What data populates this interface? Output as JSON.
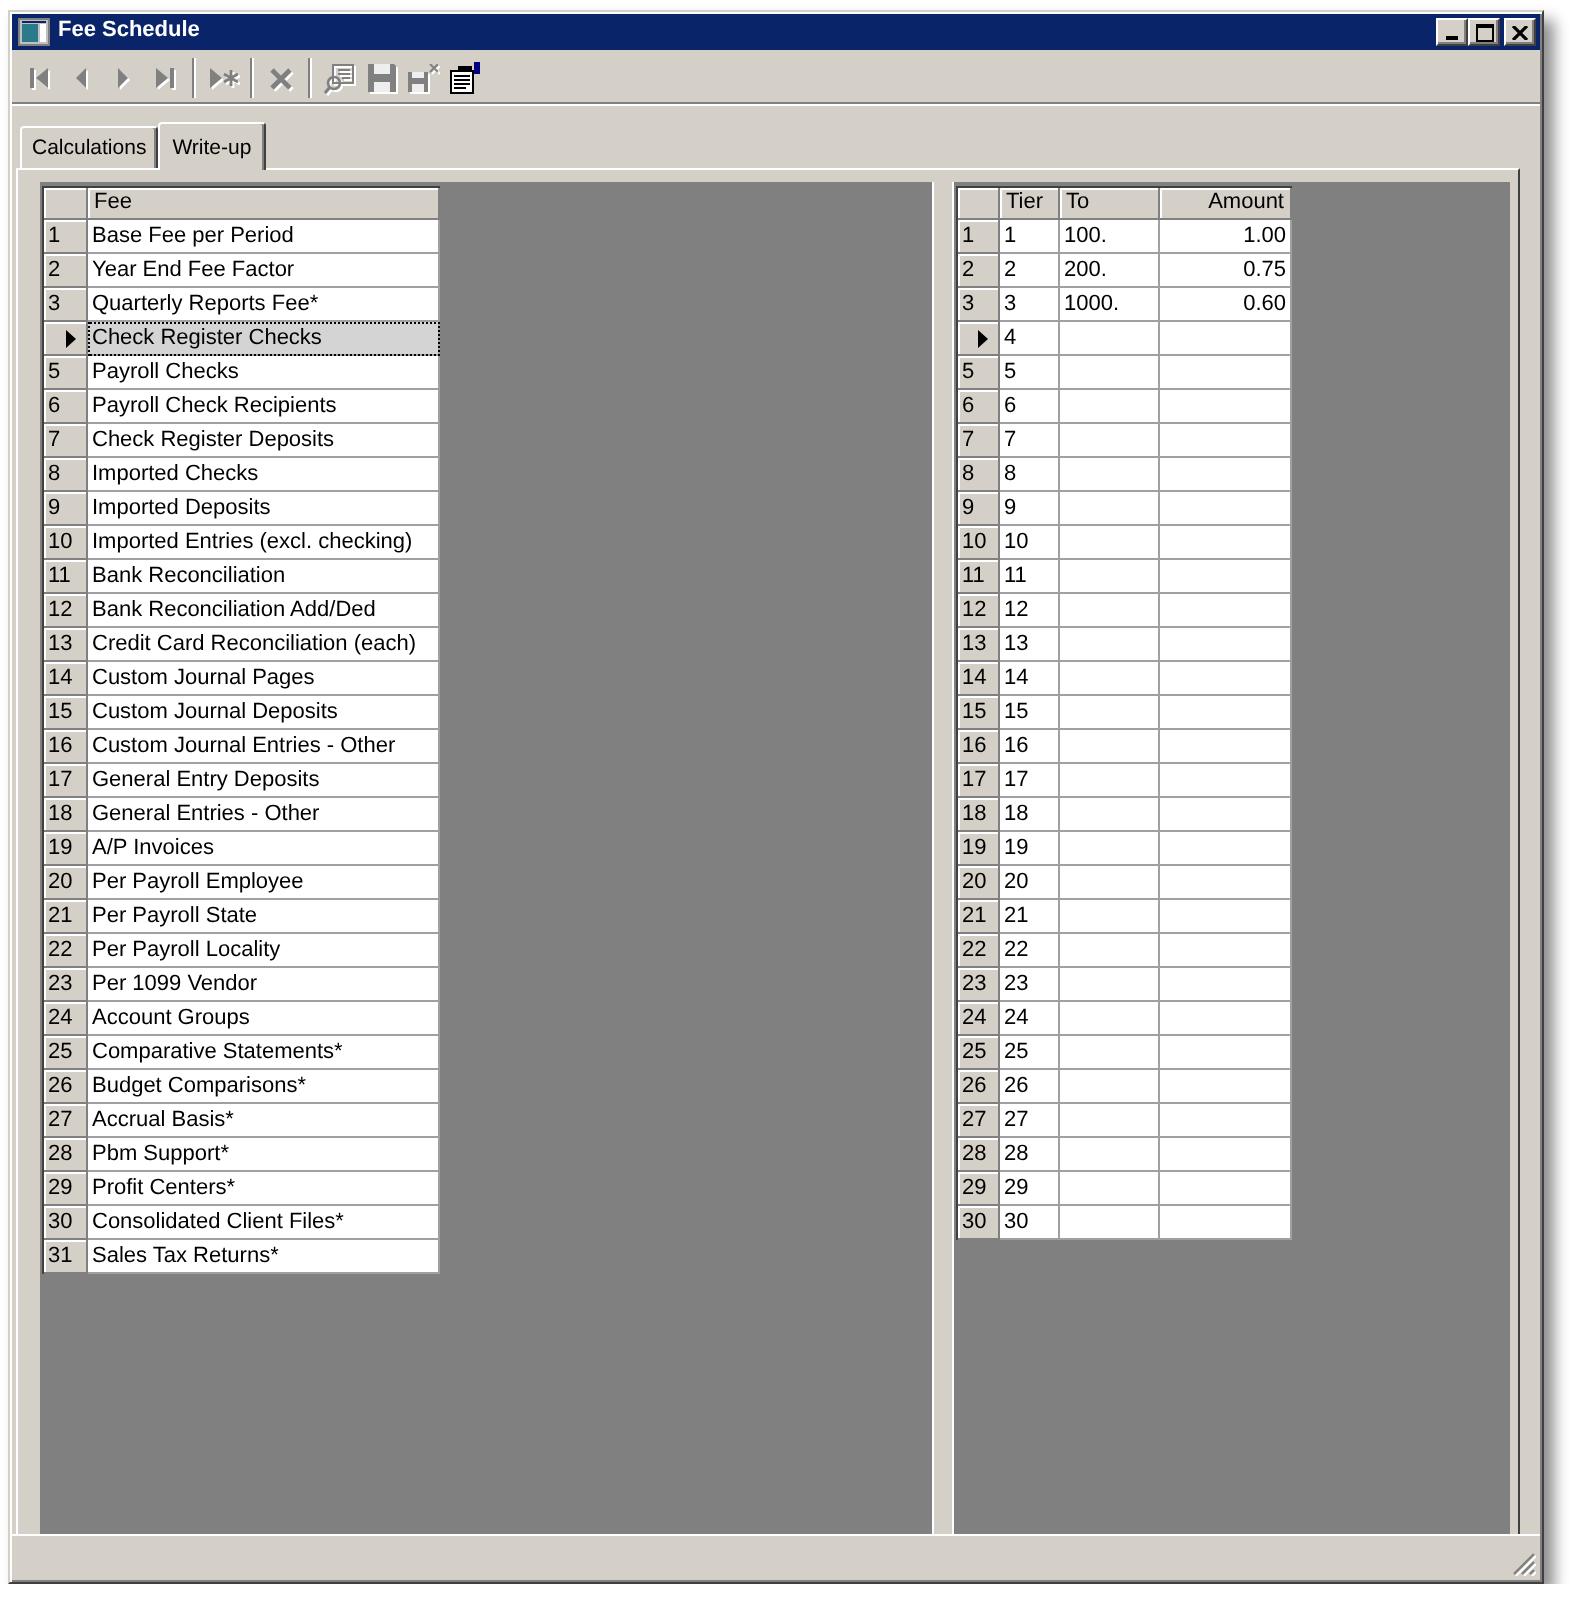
{
  "window": {
    "title": "Fee Schedule"
  },
  "toolbar": {
    "groups": [
      {
        "buttons": [
          {
            "kind": "first",
            "disabled": true
          },
          {
            "kind": "previous",
            "disabled": true
          },
          {
            "kind": "next",
            "disabled": true
          },
          {
            "kind": "last",
            "disabled": true
          }
        ]
      },
      {
        "buttons": [
          {
            "kind": "new",
            "disabled": true
          }
        ]
      },
      {
        "buttons": [
          {
            "kind": "delete",
            "disabled": true
          }
        ]
      },
      {
        "buttons": [
          {
            "kind": "find",
            "disabled": true
          },
          {
            "kind": "save",
            "disabled": true
          },
          {
            "kind": "discard",
            "disabled": true
          },
          {
            "kind": "properties",
            "disabled": false
          }
        ]
      }
    ]
  },
  "tabs": [
    {
      "label": "Calculations",
      "selected": false
    },
    {
      "label": "Write-up",
      "selected": true
    }
  ],
  "fee_grid": {
    "columns": [
      "Fee"
    ],
    "rows": [
      {
        "number": "1",
        "cells": [
          "Base Fee per Period"
        ],
        "current": false,
        "selected": false
      },
      {
        "number": "2",
        "cells": [
          "Year End Fee Factor"
        ],
        "current": false,
        "selected": false
      },
      {
        "number": "3",
        "cells": [
          "Quarterly Reports Fee*"
        ],
        "current": false,
        "selected": false
      },
      {
        "cells": [
          "Check Register Checks"
        ],
        "current": true,
        "selected": true
      },
      {
        "number": "5",
        "cells": [
          "Payroll Checks"
        ],
        "current": false,
        "selected": false
      },
      {
        "number": "6",
        "cells": [
          "Payroll Check Recipients"
        ],
        "current": false,
        "selected": false
      },
      {
        "number": "7",
        "cells": [
          "Check Register Deposits"
        ],
        "current": false,
        "selected": false
      },
      {
        "number": "8",
        "cells": [
          "Imported Checks"
        ],
        "current": false,
        "selected": false
      },
      {
        "number": "9",
        "cells": [
          "Imported Deposits"
        ],
        "current": false,
        "selected": false
      },
      {
        "number": "10",
        "cells": [
          "Imported Entries (excl. checking)"
        ],
        "current": false,
        "selected": false
      },
      {
        "number": "11",
        "cells": [
          "Bank Reconciliation"
        ],
        "current": false,
        "selected": false
      },
      {
        "number": "12",
        "cells": [
          "Bank Reconciliation Add/Ded"
        ],
        "current": false,
        "selected": false
      },
      {
        "number": "13",
        "cells": [
          "Credit Card Reconciliation (each)"
        ],
        "current": false,
        "selected": false
      },
      {
        "number": "14",
        "cells": [
          "Custom Journal Pages"
        ],
        "current": false,
        "selected": false
      },
      {
        "number": "15",
        "cells": [
          "Custom Journal Deposits"
        ],
        "current": false,
        "selected": false
      },
      {
        "number": "16",
        "cells": [
          "Custom Journal Entries - Other"
        ],
        "current": false,
        "selected": false
      },
      {
        "number": "17",
        "cells": [
          "General Entry Deposits"
        ],
        "current": false,
        "selected": false
      },
      {
        "number": "18",
        "cells": [
          "General Entries - Other"
        ],
        "current": false,
        "selected": false
      },
      {
        "number": "19",
        "cells": [
          "A/P Invoices"
        ],
        "current": false,
        "selected": false
      },
      {
        "number": "20",
        "cells": [
          "Per Payroll Employee"
        ],
        "current": false,
        "selected": false
      },
      {
        "number": "21",
        "cells": [
          "Per Payroll State"
        ],
        "current": false,
        "selected": false
      },
      {
        "number": "22",
        "cells": [
          "Per Payroll Locality"
        ],
        "current": false,
        "selected": false
      },
      {
        "number": "23",
        "cells": [
          "Per 1099 Vendor"
        ],
        "current": false,
        "selected": false
      },
      {
        "number": "24",
        "cells": [
          "Account Groups"
        ],
        "current": false,
        "selected": false
      },
      {
        "number": "25",
        "cells": [
          "Comparative Statements*"
        ],
        "current": false,
        "selected": false
      },
      {
        "number": "26",
        "cells": [
          "Budget Comparisons*"
        ],
        "current": false,
        "selected": false
      },
      {
        "number": "27",
        "cells": [
          "Accrual Basis*"
        ],
        "current": false,
        "selected": false
      },
      {
        "number": "28",
        "cells": [
          "Pbm Support*"
        ],
        "current": false,
        "selected": false
      },
      {
        "number": "29",
        "cells": [
          "Profit Centers*"
        ],
        "current": false,
        "selected": false
      },
      {
        "number": "30",
        "cells": [
          "Consolidated Client Files*"
        ],
        "current": false,
        "selected": false
      },
      {
        "number": "31",
        "cells": [
          "Sales Tax Returns*"
        ],
        "current": false,
        "selected": false
      }
    ]
  },
  "tier_grid": {
    "columns": [
      "Tier",
      "To",
      "Amount"
    ],
    "rows": [
      {
        "number": "1",
        "cells": [
          "1",
          "100.",
          "1.00"
        ],
        "current": false
      },
      {
        "number": "2",
        "cells": [
          "2",
          "200.",
          "0.75"
        ],
        "current": false
      },
      {
        "number": "3",
        "cells": [
          "3",
          "1000.",
          "0.60"
        ],
        "current": false
      },
      {
        "cells": [
          "4"
        ],
        "current": true
      },
      {
        "number": "5",
        "cells": [
          "5"
        ],
        "current": false
      },
      {
        "number": "6",
        "cells": [
          "6"
        ],
        "current": false
      },
      {
        "number": "7",
        "cells": [
          "7"
        ],
        "current": false
      },
      {
        "number": "8",
        "cells": [
          "8"
        ],
        "current": false
      },
      {
        "number": "9",
        "cells": [
          "9"
        ],
        "current": false
      },
      {
        "number": "10",
        "cells": [
          "10"
        ],
        "current": false
      },
      {
        "number": "11",
        "cells": [
          "11"
        ],
        "current": false
      },
      {
        "number": "12",
        "cells": [
          "12"
        ],
        "current": false
      },
      {
        "number": "13",
        "cells": [
          "13"
        ],
        "current": false
      },
      {
        "number": "14",
        "cells": [
          "14"
        ],
        "current": false
      },
      {
        "number": "15",
        "cells": [
          "15"
        ],
        "current": false
      },
      {
        "number": "16",
        "cells": [
          "16"
        ],
        "current": false
      },
      {
        "number": "17",
        "cells": [
          "17"
        ],
        "current": false
      },
      {
        "number": "18",
        "cells": [
          "18"
        ],
        "current": false
      },
      {
        "number": "19",
        "cells": [
          "19"
        ],
        "current": false
      },
      {
        "number": "20",
        "cells": [
          "20"
        ],
        "current": false
      },
      {
        "number": "21",
        "cells": [
          "21"
        ],
        "current": false
      },
      {
        "number": "22",
        "cells": [
          "22"
        ],
        "current": false
      },
      {
        "number": "23",
        "cells": [
          "23"
        ],
        "current": false
      },
      {
        "number": "24",
        "cells": [
          "24"
        ],
        "current": false
      },
      {
        "number": "25",
        "cells": [
          "25"
        ],
        "current": false
      },
      {
        "number": "26",
        "cells": [
          "26"
        ],
        "current": false
      },
      {
        "number": "27",
        "cells": [
          "27"
        ],
        "current": false
      },
      {
        "number": "28",
        "cells": [
          "28"
        ],
        "current": false
      },
      {
        "number": "29",
        "cells": [
          "29"
        ],
        "current": false
      },
      {
        "number": "30",
        "cells": [
          "30"
        ],
        "current": false
      }
    ]
  }
}
